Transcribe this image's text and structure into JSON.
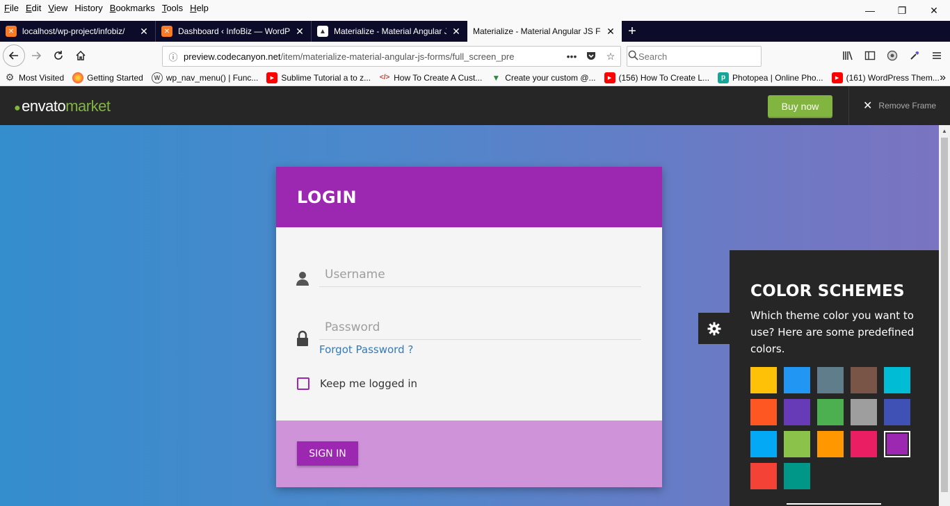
{
  "menu": {
    "items": [
      {
        "label": "File",
        "key": "F",
        "rest": "ile"
      },
      {
        "label": "Edit",
        "key": "E",
        "rest": "dit"
      },
      {
        "label": "View",
        "key": "V",
        "rest": "iew"
      },
      {
        "label": "History",
        "key": "",
        "rest": "History"
      },
      {
        "label": "Bookmarks",
        "key": "B",
        "rest": "ookmarks"
      },
      {
        "label": "Tools",
        "key": "T",
        "rest": "ools"
      },
      {
        "label": "Help",
        "key": "H",
        "rest": "elp"
      }
    ]
  },
  "window_controls": {
    "minimize": "—",
    "restore": "❐",
    "close": "✕"
  },
  "tabs": [
    {
      "label": "localhost/wp-project/infobiz/",
      "icon": "xampp-icon",
      "active": false
    },
    {
      "label": "Dashboard ‹ InfoBiz — WordPr",
      "icon": "xampp-icon",
      "active": false
    },
    {
      "label": "Materialize - Material Angular J",
      "icon": "page-icon",
      "active": false
    },
    {
      "label": "Materialize - Material Angular JS Fo",
      "icon": "none",
      "active": true
    }
  ],
  "tab_close": "✕",
  "new_tab": "+",
  "nav": {
    "url_host": "preview.codecanyon.net",
    "url_path": "/item/materialize-material-angular-js-forms/full_screen_pre",
    "search_placeholder": "Search",
    "page_actions": "•••"
  },
  "bookmarks": [
    {
      "label": "Most Visited",
      "icon": "gear-icon"
    },
    {
      "label": "Getting Started",
      "icon": "firefox-icon"
    },
    {
      "label": "wp_nav_menu() | Func...",
      "icon": "wordpress-icon"
    },
    {
      "label": "Sublime Tutorial a to z...",
      "icon": "youtube-icon"
    },
    {
      "label": "How To Create A Cust...",
      "icon": "site-icon"
    },
    {
      "label": "Create your custom @...",
      "icon": "vue-icon"
    },
    {
      "label": "(156) How To Create L...",
      "icon": "youtube-icon"
    },
    {
      "label": "Photopea | Online Pho...",
      "icon": "photopea-icon"
    },
    {
      "label": "(161) WordPress Them...",
      "icon": "youtube-icon"
    }
  ],
  "envato": {
    "logo_word1": "envato",
    "logo_word2": "market",
    "buy_now": "Buy now",
    "remove_frame": "Remove Frame"
  },
  "login": {
    "title": "LOGIN",
    "username_placeholder": "Username",
    "password_placeholder": "Password",
    "forgot": "Forgot Password ?",
    "remember": "Keep me logged in",
    "signin": "SIGN IN"
  },
  "color_schemes": {
    "title": "COLOR SCHEMES",
    "description": "Which theme color you want to use? Here are some predefined colors.",
    "swatches": [
      "#ffc107",
      "#2196f3",
      "#607d8b",
      "#795548",
      "#00bcd4",
      "#ff5722",
      "#673ab7",
      "#4caf50",
      "#9e9e9e",
      "#3f51b5",
      "#03a9f4",
      "#8bc34a",
      "#ff9800",
      "#e91e63",
      "#9c27b0",
      "#f44336",
      "#009688"
    ],
    "selected_index": 14
  },
  "colors": {
    "accent": "#9c27b0",
    "envato_green": "#82b440",
    "dark": "#262626"
  }
}
